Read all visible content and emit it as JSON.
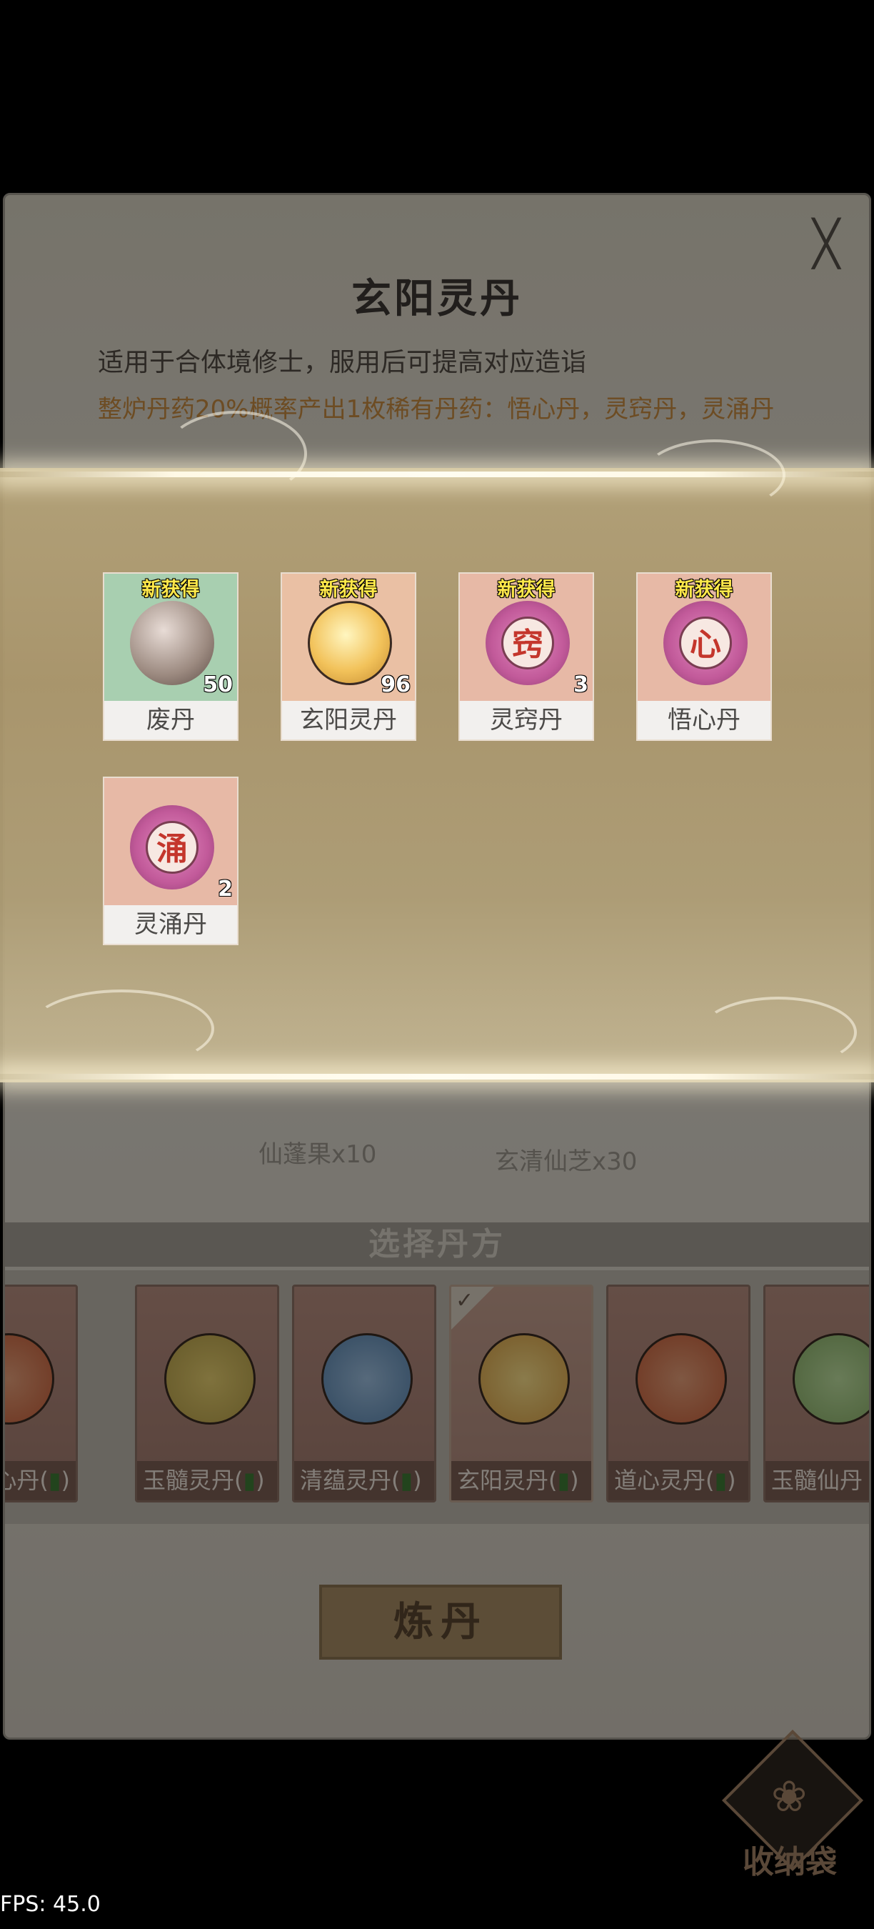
{
  "dialog": {
    "close_glyph": "╳",
    "title": "玄阳灵丹",
    "description": "适用于合体境修士，服用后可提高对应造诣",
    "bonus_text": "整炉丹药20%概率产出1枚稀有丹药：悟心丹，灵窍丹，灵涌丹"
  },
  "materials": [
    "仙蓬果x10",
    "玄清仙芝x30"
  ],
  "select_header": "选择丹方",
  "recipes": [
    {
      "name": "道心丹",
      "suffix": "",
      "color": "#c9603a",
      "selected": false
    },
    {
      "name": "玉髓灵丹",
      "suffix": "",
      "color": "#b8a14a",
      "selected": false
    },
    {
      "name": "清蕴灵丹",
      "suffix": "",
      "color": "#5b86b0",
      "selected": false
    },
    {
      "name": "玄阳灵丹",
      "suffix": "",
      "color": "#d9a146",
      "selected": true
    },
    {
      "name": "道心灵丹",
      "suffix": "",
      "color": "#c9603a",
      "selected": false
    },
    {
      "name": "玉髓仙丹",
      "suffix": "",
      "color": "#8bb26a",
      "selected": false
    }
  ],
  "recipe_paren_open": "(",
  "recipe_paren_close": ")",
  "recipe_green_mark": "▮",
  "refine_button": "炼丹",
  "results": [
    {
      "tag": "新获得",
      "name": "废丹",
      "count": "50",
      "bg": "green",
      "orb_color": "#9c8a80",
      "char": ""
    },
    {
      "tag": "新获得",
      "name": "玄阳灵丹",
      "count": "96",
      "bg": "pink",
      "orb_color": "#f2c25a",
      "char": ""
    },
    {
      "tag": "新获得",
      "name": "灵窍丹",
      "count": "3",
      "bg": "pink",
      "orb_color": "#c25a9a",
      "char": "窍"
    },
    {
      "tag": "新获得",
      "name": "悟心丹",
      "count": "",
      "bg": "pink",
      "orb_color": "#c25a9a",
      "char": "心"
    },
    {
      "tag": "新获得",
      "name": "灵涌丹",
      "count": "2",
      "bg": "pink",
      "orb_color": "#c25a9a",
      "char": "涌"
    }
  ],
  "storage": {
    "label": "收纳袋",
    "icon": "bag-icon",
    "glyph": "❀"
  },
  "fps": "FPS: 45.0"
}
